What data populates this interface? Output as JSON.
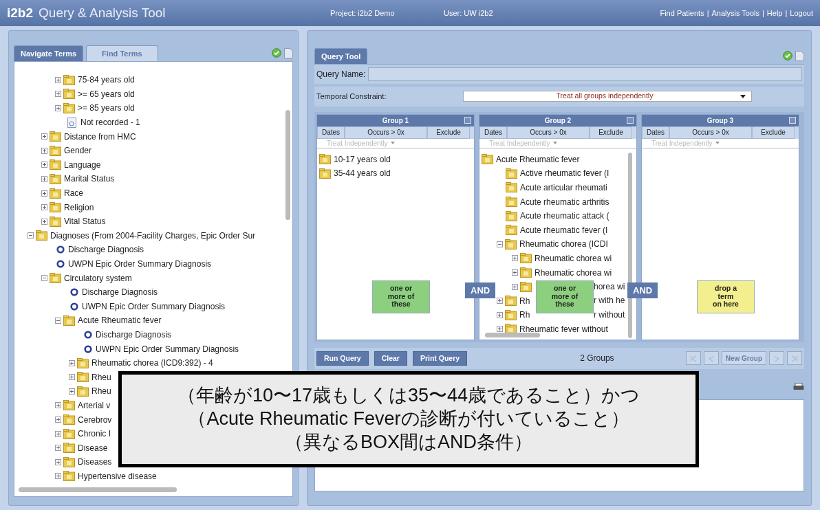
{
  "header": {
    "logo": "i2b2",
    "title": "Query & Analysis Tool",
    "project": "Project: i2b2 Demo",
    "user": "User: UW i2b2",
    "links": [
      "Find Patients",
      "Analysis Tools",
      "Help",
      "Logout"
    ],
    "separator": "|"
  },
  "left_panel": {
    "tabs": [
      {
        "label": "Navigate Terms",
        "selected": true
      },
      {
        "label": "Find Terms",
        "selected": false
      }
    ],
    "tree": [
      {
        "children": [
          {
            "children": [
              {
                "kind": "folder",
                "label": "75-84 years old",
                "expanded": false
              },
              {
                "kind": "folder",
                "label": ">= 65 years old",
                "expanded": false
              },
              {
                "kind": "folder",
                "label": ">= 85 years old",
                "expanded": false
              },
              {
                "kind": "leaf",
                "label": "Not recorded - 1"
              }
            ]
          },
          {
            "kind": "folder",
            "label": "Distance from HMC",
            "expanded": false
          },
          {
            "kind": "folder",
            "label": "Gender",
            "expanded": false
          },
          {
            "kind": "folder",
            "label": "Language",
            "expanded": false
          },
          {
            "kind": "folder",
            "label": "Marital Status",
            "expanded": false
          },
          {
            "kind": "folder",
            "label": "Race",
            "expanded": false
          },
          {
            "kind": "folder",
            "label": "Religion",
            "expanded": false
          },
          {
            "kind": "folder",
            "label": "Vital Status",
            "expanded": false
          }
        ]
      },
      {
        "kind": "folder",
        "label": "Diagnoses (From 2004-Facility Charges, Epic Order Sur",
        "expanded": true,
        "children": [
          {
            "kind": "modifier",
            "label": "Discharge Diagnosis"
          },
          {
            "kind": "modifier",
            "label": "UWPN Epic Order Summary Diagnosis"
          },
          {
            "kind": "folder",
            "label": "Circulatory system",
            "expanded": true,
            "children": [
              {
                "kind": "modifier",
                "label": "Discharge Diagnosis"
              },
              {
                "kind": "modifier",
                "label": "UWPN Epic Order Summary Diagnosis"
              },
              {
                "kind": "folder",
                "label": "Acute Rheumatic fever",
                "expanded": true,
                "children": [
                  {
                    "kind": "modifier",
                    "label": "Discharge Diagnosis"
                  },
                  {
                    "kind": "modifier",
                    "label": "UWPN Epic Order Summary Diagnosis"
                  },
                  {
                    "kind": "folder",
                    "label": "Rheumatic chorea (ICD9:392) - 4",
                    "expanded": false
                  },
                  {
                    "kind": "folder",
                    "label": "Rheu",
                    "expanded": false
                  },
                  {
                    "kind": "folder",
                    "label": "Rheu",
                    "expanded": false
                  }
                ]
              },
              {
                "kind": "folder",
                "label": "Arterial v",
                "expanded": false
              },
              {
                "kind": "folder",
                "label": "Cerebrov",
                "expanded": false
              },
              {
                "kind": "folder",
                "label": "Chronic I",
                "expanded": false
              },
              {
                "kind": "folder",
                "label": "Disease",
                "expanded": false
              },
              {
                "kind": "folder",
                "label": "Diseases",
                "expanded": false
              },
              {
                "kind": "folder",
                "label": "Hypertensive disease",
                "expanded": false
              }
            ]
          }
        ]
      }
    ]
  },
  "query_tool": {
    "tabs": [
      {
        "label": "Query Tool",
        "selected": true
      }
    ],
    "query_name_label": "Query Name:",
    "temporal_label": "Temporal Constraint:",
    "temporal_value": "Treat all groups independently",
    "groups": [
      {
        "title": "Group 1",
        "columns": [
          "Dates",
          "Occurs > 0x",
          "Exclude"
        ],
        "timing": "Treat Independently",
        "hint": {
          "kind": "filled",
          "lines": [
            "one or",
            "more of",
            "these"
          ]
        },
        "items": [
          {
            "kind": "folder",
            "label": "10-17 years old"
          },
          {
            "kind": "folder",
            "label": "35-44 years old"
          }
        ]
      },
      {
        "title": "Group 2",
        "columns": [
          "Dates",
          "Occurs > 0x",
          "Exclude"
        ],
        "timing": "Treat Independently",
        "hint": {
          "kind": "filled",
          "lines": [
            "one or",
            "more of",
            "these"
          ]
        },
        "items": [
          {
            "kind": "folder",
            "label": "Acute Rheumatic fever",
            "children": [
              {
                "kind": "folder",
                "label": "Active rheumatic fever (I"
              },
              {
                "kind": "folder",
                "label": "Acute articular rheumati"
              },
              {
                "kind": "folder",
                "label": "Acute rheumatic arthritis"
              },
              {
                "kind": "folder",
                "label": "Acute rheumatic attack ("
              },
              {
                "kind": "folder",
                "label": "Acute rheumatic fever (I"
              },
              {
                "kind": "folder",
                "label": "Rheumatic chorea (ICDI",
                "expanded": true,
                "children": [
                  {
                    "kind": "folder",
                    "label": "Rheumatic chorea wi",
                    "expanded": false
                  },
                  {
                    "kind": "folder",
                    "label": "Rheumatic chorea wi",
                    "expanded": false
                  },
                  {
                    "kind": "folder",
                    "after": "horea wi",
                    "expanded": false
                  }
                ]
              },
              {
                "kind": "folder",
                "label": "Rh",
                "after": "r with he",
                "expanded": false
              },
              {
                "kind": "folder",
                "label": "Rh",
                "after": "r without",
                "expanded": false
              },
              {
                "kind": "folder",
                "label": "Rheumatic fever without",
                "expanded": false
              }
            ]
          }
        ]
      },
      {
        "title": "Group 3",
        "columns": [
          "Dates",
          "Occurs > 0x",
          "Exclude"
        ],
        "timing": "Treat Independently",
        "hint": {
          "kind": "empty",
          "lines": [
            "drop a",
            "term",
            "on here"
          ]
        }
      }
    ],
    "connectors": [
      "AND",
      "AND"
    ],
    "buttons": [
      "Run Query",
      "Clear",
      "Print Query"
    ],
    "group_count": "2 Groups",
    "new_group": "New Group"
  },
  "callout": {
    "lines": [
      "（年齢が10〜17歳もしくは35〜44歳であること）かつ",
      "（Acute Rheumatic Feverの診断が付いていること）",
      "（異なるBOX間はAND条件）"
    ]
  }
}
